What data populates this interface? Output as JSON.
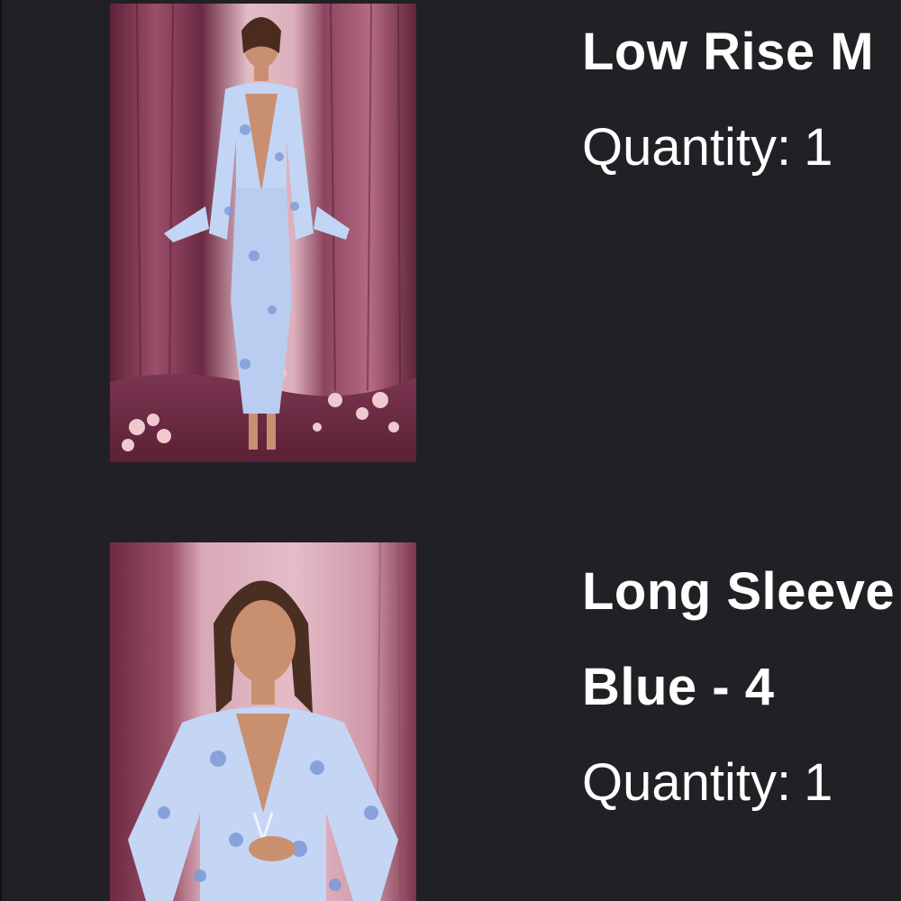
{
  "cart": {
    "items": [
      {
        "title": "Low Rise M",
        "quantity_label": "Quantity:",
        "quantity": "1"
      },
      {
        "title": "Long Sleeve",
        "variant": "Blue - 4",
        "quantity_label": "Quantity:",
        "quantity": "1"
      }
    ]
  },
  "colors": {
    "background": "#212125",
    "text": "#ffffff",
    "curtain_dark": "#7a3850",
    "curtain_light": "#d7a6b2",
    "outfit": "#b9cdf0"
  }
}
